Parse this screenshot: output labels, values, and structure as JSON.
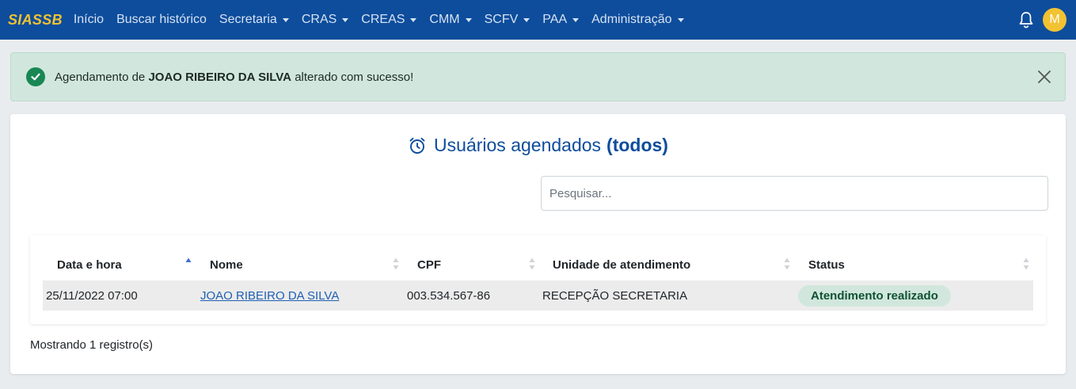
{
  "nav": {
    "brand": "SIASSB",
    "items": [
      {
        "label": "Início",
        "dropdown": false
      },
      {
        "label": "Buscar histórico",
        "dropdown": false
      },
      {
        "label": "Secretaria",
        "dropdown": true
      },
      {
        "label": "CRAS",
        "dropdown": true
      },
      {
        "label": "CREAS",
        "dropdown": true
      },
      {
        "label": "CMM",
        "dropdown": true
      },
      {
        "label": "SCFV",
        "dropdown": true
      },
      {
        "label": "PAA",
        "dropdown": true
      },
      {
        "label": "Administração",
        "dropdown": true
      }
    ],
    "avatar_initial": "M"
  },
  "alert": {
    "prefix": "Agendamento de",
    "name": "JOAO RIBEIRO DA SILVA",
    "suffix": "alterado com sucesso!"
  },
  "card": {
    "title": "Usuários agendados",
    "title_bold": "(todos)",
    "search_placeholder": "Pesquisar..."
  },
  "table": {
    "headers": [
      "Data e hora",
      "Nome",
      "CPF",
      "Unidade de atendimento",
      "Status"
    ],
    "rows": [
      {
        "datetime": "25/11/2022 07:00",
        "name": "JOAO RIBEIRO DA SILVA",
        "cpf": "003.534.567-86",
        "unit": "RECEPÇÃO SECRETARIA",
        "status": "Atendimento realizado"
      }
    ],
    "footer": "Mostrando 1 registro(s)"
  },
  "colors": {
    "primary": "#0d4d9c",
    "brand": "#f1c232",
    "success_bg": "#d1e7dd",
    "success": "#198754"
  }
}
